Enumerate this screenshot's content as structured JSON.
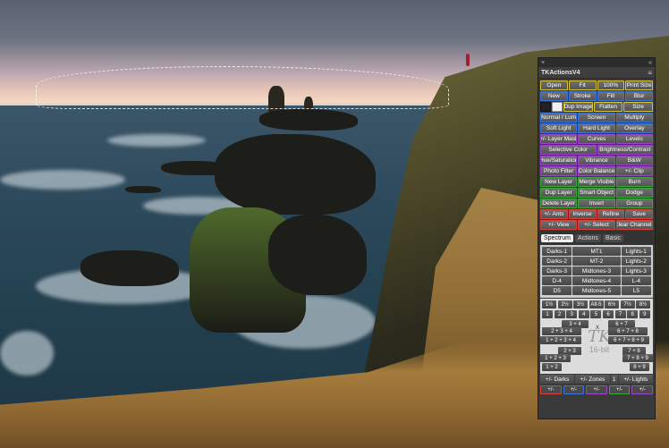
{
  "panel": {
    "title": "TKActionsV4",
    "close_glyph": "×",
    "menu_glyph": "≡",
    "collapse_glyph": "«"
  },
  "rows": [
    [
      {
        "label": "Open",
        "color": "yellow"
      },
      {
        "label": "Fit",
        "color": "yellow"
      },
      {
        "label": "100%",
        "color": "yellow"
      },
      {
        "label": "Print Size",
        "color": "yellow"
      }
    ],
    [
      {
        "label": "New",
        "color": "blue"
      },
      {
        "label": "Stroke",
        "color": "blue"
      },
      {
        "label": "Fill",
        "color": "blue"
      },
      {
        "label": "Blur",
        "color": "blue"
      }
    ],
    [
      {
        "label": "",
        "color": "dark"
      },
      {
        "label": "",
        "color": "white"
      },
      {
        "label": "Dup Image",
        "color": "yellow"
      },
      {
        "label": "Flatten",
        "color": "yellow"
      },
      {
        "label": "Size",
        "color": "yellow"
      }
    ],
    [
      {
        "label": "Normal / Lum",
        "color": "blue"
      },
      {
        "label": "Screen",
        "color": "blue"
      },
      {
        "label": "Multiply",
        "color": "blue"
      }
    ],
    [
      {
        "label": "Soft Light",
        "color": "blue"
      },
      {
        "label": "Hard Light",
        "color": "blue"
      },
      {
        "label": "Overlay",
        "color": "blue"
      }
    ],
    [
      {
        "label": "+/- Layer Mask",
        "color": "purple"
      },
      {
        "label": "Curves",
        "color": "purple"
      },
      {
        "label": "Levels",
        "color": "purple"
      }
    ],
    [
      {
        "label": "Selective Color",
        "color": "purple"
      },
      {
        "label": "Brightness/Contrast",
        "color": "purple"
      }
    ],
    [
      {
        "label": "Hue/Saturation",
        "color": "purple"
      },
      {
        "label": "Vibrance",
        "color": "purple"
      },
      {
        "label": "B&W",
        "color": "purple"
      }
    ],
    [
      {
        "label": "Photo Filter",
        "color": "purple"
      },
      {
        "label": "Color Balance",
        "color": "purple"
      },
      {
        "label": "+/- Clip",
        "color": "purple"
      }
    ],
    [
      {
        "label": "New Layer",
        "color": "green"
      },
      {
        "label": "Merge Visible",
        "color": "green"
      },
      {
        "label": "Burn",
        "color": "green"
      }
    ],
    [
      {
        "label": "Dup Layer",
        "color": "green"
      },
      {
        "label": "Smart Object",
        "color": "green"
      },
      {
        "label": "Dodge",
        "color": "green"
      }
    ],
    [
      {
        "label": "Delete Layer",
        "color": "green"
      },
      {
        "label": "Invert",
        "color": "green"
      },
      {
        "label": "Group",
        "color": "green"
      }
    ],
    [
      {
        "label": "+/- Ants",
        "color": "red"
      },
      {
        "label": "Inverse",
        "color": "red"
      },
      {
        "label": "Refine",
        "color": "red"
      },
      {
        "label": "Save",
        "color": "red"
      }
    ],
    [
      {
        "label": "+/- View",
        "color": "red"
      },
      {
        "label": "+/- Select",
        "color": "red"
      },
      {
        "label": "Clear Channels",
        "color": "red"
      }
    ]
  ],
  "tabs": [
    "Spectrum",
    "Actions",
    "Basic"
  ],
  "spectrum_rows": [
    [
      "Darks-1",
      "MT1",
      "Lights-1"
    ],
    [
      "Darks-2",
      "MT-2",
      "Lights-2"
    ],
    [
      "Darks-3",
      "Midtones-3",
      "Lights-3"
    ],
    [
      "D-4",
      "Midtones-4",
      "L-4"
    ],
    [
      "D5",
      "Midtones-5",
      "L5"
    ]
  ],
  "grid": {
    "top": [
      "1½",
      "2½",
      "3½",
      "All-5",
      "6½",
      "7½",
      "8½"
    ],
    "nums": [
      "1",
      "2",
      "3",
      "4",
      "5",
      "6",
      "7",
      "8",
      "9"
    ],
    "combos_left": [
      "3 + 4",
      "2 + 3 + 4",
      "1 + 2 + 3 + 4",
      "2 + 3",
      "1 + 2 + 3",
      "1 + 2"
    ],
    "combos_right": [
      "6 + 7",
      "6 + 7 + 8",
      "6 + 7 + 8 + 9",
      "7 + 8",
      "7 + 8 + 9",
      "8 + 9"
    ],
    "x": "X",
    "logo": "TK",
    "bitdepth": "16-bit"
  },
  "bottom": [
    "+/- Darks",
    "+/- Zones",
    "1",
    "+/- Lights"
  ],
  "color_row": [
    "+/-",
    "+/-",
    "+/-",
    "+/-",
    "+/-"
  ],
  "colors": {
    "yellow": "#d8c43a",
    "blue": "#3b74d8",
    "purple": "#9b45c8",
    "green": "#3fa63f",
    "red": "#d8403a"
  }
}
